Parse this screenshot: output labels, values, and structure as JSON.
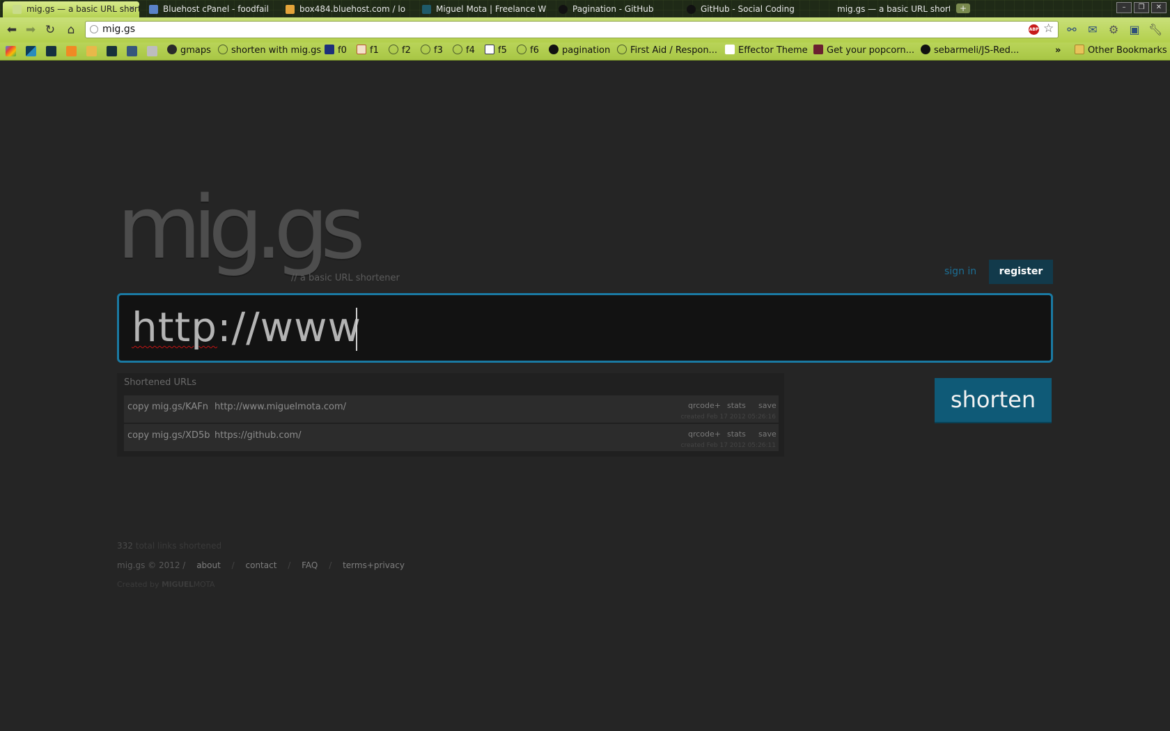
{
  "browser": {
    "tabs": [
      {
        "title": "mig.gs — a basic URL short",
        "active": true
      },
      {
        "title": "Bluehost cPanel - foodfail"
      },
      {
        "title": "box484.bluehost.com / lo"
      },
      {
        "title": "Miguel Mota | Freelance W"
      },
      {
        "title": "Pagination - GitHub"
      },
      {
        "title": "GitHub - Social Coding"
      },
      {
        "title": "mig.gs — a basic URL short"
      }
    ],
    "close_tab_glyph": "✕",
    "new_tab_glyph": "+",
    "url": "mig.gs",
    "bookmarks": [
      {
        "label": "gmaps"
      },
      {
        "label": "shorten with mig.gs"
      },
      {
        "label": "f0"
      },
      {
        "label": "f1"
      },
      {
        "label": "f2"
      },
      {
        "label": "f3"
      },
      {
        "label": "f4"
      },
      {
        "label": "f5"
      },
      {
        "label": "f6"
      },
      {
        "label": "pagination"
      },
      {
        "label": "First Aid / Respon..."
      },
      {
        "label": "Effector Theme"
      },
      {
        "label": "Get your popcorn..."
      },
      {
        "label": "sebarmeli/JS-Red..."
      }
    ],
    "bookmarks_overflow": "»",
    "other_bookmarks": "Other Bookmarks",
    "abp_label": "ABP"
  },
  "page": {
    "logo": "mig.gs",
    "tagline": "// a basic URL shortener",
    "sign_in": "sign in",
    "register": "register",
    "input_value_underlined": "http",
    "input_value_rest": "://www",
    "shorten": "shorten",
    "list_title": "Shortened URLs",
    "links": [
      {
        "copy": "copy",
        "short": "mig.gs/KAFn",
        "long": "http://www.miguelmota.com/",
        "qrcode": "qrcode+",
        "stats": "stats",
        "save": "save",
        "created": "created Feb 17 2012 05:26:16"
      },
      {
        "copy": "copy",
        "short": "mig.gs/XD5b",
        "long": "https://github.com/",
        "qrcode": "qrcode+",
        "stats": "stats",
        "save": "save",
        "created": "created Feb 17 2012 05:26:11"
      }
    ],
    "footer": {
      "count": "332",
      "count_label": "total links shortened",
      "copyright": "mig.gs © 2012 /",
      "about": "about",
      "contact": "contact",
      "faq": "FAQ",
      "terms": "terms+privacy",
      "separator": "/",
      "created_by": "Created by",
      "author_bold": "MIGUEL",
      "author_rest": "MOTA"
    }
  },
  "colors": {
    "background": "#252525",
    "accent": "#1a7aa3",
    "button": "#0f5a77",
    "chrome_green": "#b3cf4c"
  }
}
